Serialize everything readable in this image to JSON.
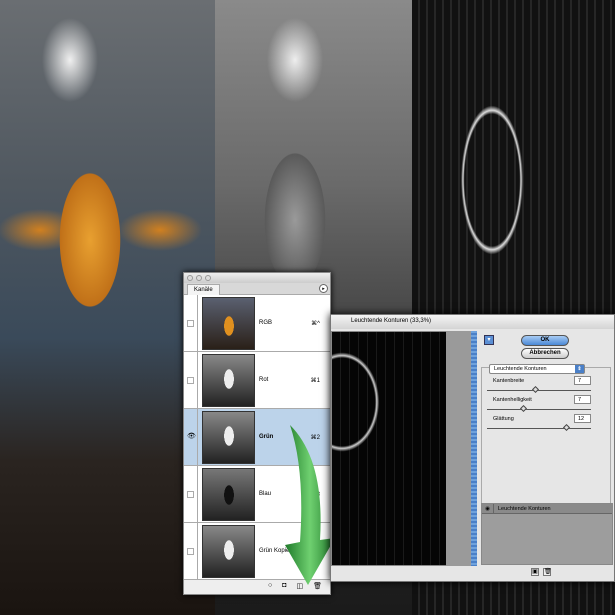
{
  "channels_panel": {
    "tab": "Kanäle",
    "rows": [
      {
        "name": "RGB",
        "shortcut": "⌘^",
        "visible": false,
        "selected": false
      },
      {
        "name": "Rot",
        "shortcut": "⌘1",
        "visible": false,
        "selected": false
      },
      {
        "name": "Grün",
        "shortcut": "⌘2",
        "visible": true,
        "selected": true
      },
      {
        "name": "Blau",
        "shortcut": "⌘3",
        "visible": false,
        "selected": false
      },
      {
        "name": "Grün Kopie",
        "shortcut": "",
        "visible": false,
        "selected": false
      }
    ]
  },
  "filter_dialog": {
    "title": "Leuchtende Konturen (33,3%)",
    "ok": "OK",
    "cancel": "Abbrechen",
    "filter": "Leuchtende Konturen",
    "params": [
      {
        "label": "Kantenbreite",
        "value": "7"
      },
      {
        "label": "Kantenhelligkeit",
        "value": "7"
      },
      {
        "label": "Glättung",
        "value": "12"
      }
    ],
    "layer": "Leuchtende Konturen"
  },
  "colors": {
    "selection": "#bcd3ea",
    "arrow": "#2e9a3a",
    "ok_button": "#4a88d6"
  }
}
